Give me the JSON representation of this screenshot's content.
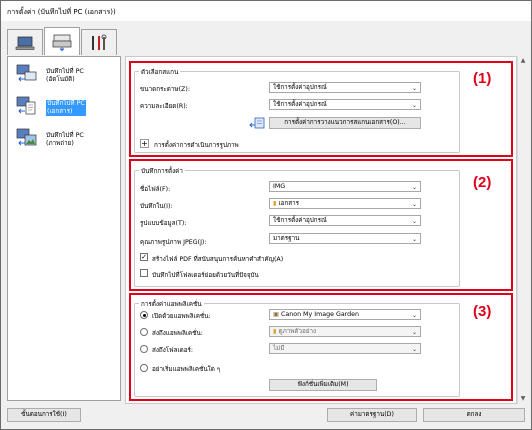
{
  "window": {
    "title": "การตั้งค่า (บันทึกไปที่ PC (เอกสาร))"
  },
  "tabs": [
    {
      "name": "scan-from-operation-panel-tab",
      "icon": "computer-scan-icon"
    },
    {
      "name": "scan-to-pc-tab",
      "icon": "scanner-icon"
    },
    {
      "name": "general-settings-tab",
      "icon": "tools-icon"
    }
  ],
  "left_panel": {
    "items": [
      {
        "label_1": "บันทึกไปที่ PC",
        "label_2": "(อัตโนมัติ)",
        "selected": false
      },
      {
        "label_1": "บันทึกไปที่ PC",
        "label_2": "(เอกสาร)",
        "selected": true
      },
      {
        "label_1": "บันทึกไปที่ PC",
        "label_2": "(ภาพถ่าย)",
        "selected": false
      }
    ]
  },
  "scan_options": {
    "title": "ตัวเลือกสแกน",
    "paper_size_label": "ขนาดกระดาษ(Z):",
    "paper_size_value": "ใช้การตั้งค่าอุปกรณ์",
    "resolution_label": "ความละเอียด(R):",
    "resolution_value": "ใช้การตั้งค่าอุปกรณ์",
    "driver_button": "การตั้งค่าการวางแนวการสแกนเอกสาร(O)...",
    "image_processing_label": "การตั้งค่าการดำเนินการรูปภาพ"
  },
  "save_settings": {
    "title": "บันทึกการตั้งค่า",
    "file_name_label": "ชื่อไฟล์(F):",
    "file_name_value": "IMG",
    "save_in_label": "บันทึกใน(I):",
    "save_in_value": "เอกสาร",
    "data_format_label": "รูปแบบข้อมูล(T):",
    "data_format_value": "ใช้การตั้งค่าอุปกรณ์",
    "jpeg_quality_label": "คุณภาพรูปภาพ JPEG(J):",
    "jpeg_quality_value": "มาตรฐาน",
    "searchable_pdf_label": "สร้างไฟล์ PDF ที่สนับสนุนการค้นหาคำสำคัญ(A)",
    "searchable_pdf_checked": true,
    "subfolder_label": "บันทึกไปที่โฟลเดอร์ย่อยด้วยวันที่ปัจจุบัน",
    "subfolder_checked": false
  },
  "app_settings": {
    "title": "การตั้งค่าแอพพลิเคชั่น",
    "open_app_label": "เปิดด้วยแอพพลิเคชั่น:",
    "open_app_value": "Canon My Image Garden",
    "send_app_label": "ส่งถึงแอพพลิเคชั่น:",
    "send_app_value": "ดูภาพตัวอย่าง",
    "send_folder_label": "ส่งถึงโฟลเดอร์:",
    "send_folder_value": "ไม่มี",
    "no_app_label": "อย่าเริ่มแอพพลิเคชั่นใด ๆ",
    "more_functions_button": "ฟังก์ชั่นเพิ่มเติม(M)"
  },
  "section_numbers": [
    "(1)",
    "(2)",
    "(3)"
  ],
  "footer": {
    "instructions_button": "ขั้นตอนการใช้(I)",
    "defaults_button": "ค่ามาตรฐาน(D)",
    "ok_button": "ตกลง"
  },
  "colors": {
    "highlight_red": "#e0001a",
    "selection_blue": "#3399ff"
  }
}
